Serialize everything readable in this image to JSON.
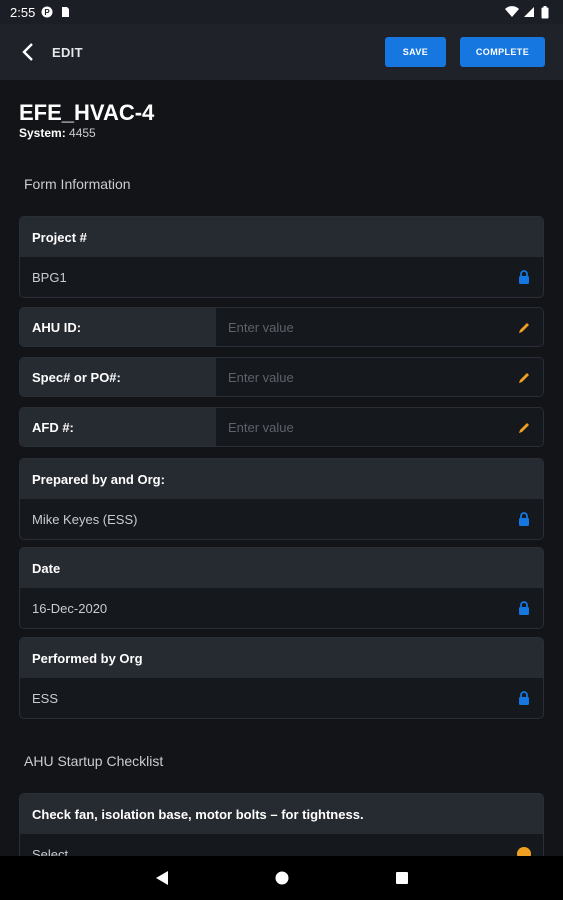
{
  "status_bar": {
    "time": "2:55",
    "icons": [
      "p-badge-icon",
      "sd-card-icon",
      "wifi-icon",
      "signal-icon",
      "battery-icon"
    ]
  },
  "app_bar": {
    "title": "EDIT",
    "save_label": "SAVE",
    "complete_label": "COMPLETE",
    "accent_color": "#1677e0"
  },
  "header": {
    "title": "EFE_HVAC-4",
    "system_label": "System:",
    "system_value": "4455"
  },
  "sections": {
    "form_information": "Form Information",
    "checklist": "AHU Startup Checklist"
  },
  "fields": {
    "project": {
      "label": "Project #",
      "value": "BPG1"
    },
    "ahu_id": {
      "label": "AHU ID:",
      "placeholder": "Enter value"
    },
    "spec": {
      "label": "Spec# or PO#:",
      "placeholder": "Enter value"
    },
    "afd": {
      "label": "AFD #:",
      "placeholder": "Enter value"
    },
    "prepared_by": {
      "label": "Prepared by and Org:",
      "value": "Mike Keyes (ESS)"
    },
    "date": {
      "label": "Date",
      "value": "16-Dec-2020"
    },
    "performed_by": {
      "label": "Performed by Org",
      "value": "ESS"
    }
  },
  "checklist": {
    "item1": {
      "label": "Check fan, isolation base, motor bolts – for tightness.",
      "value": "Select"
    }
  },
  "colors": {
    "lock": "#1677e0",
    "edit": "#f0a020",
    "status_pending": "#f0a020"
  }
}
